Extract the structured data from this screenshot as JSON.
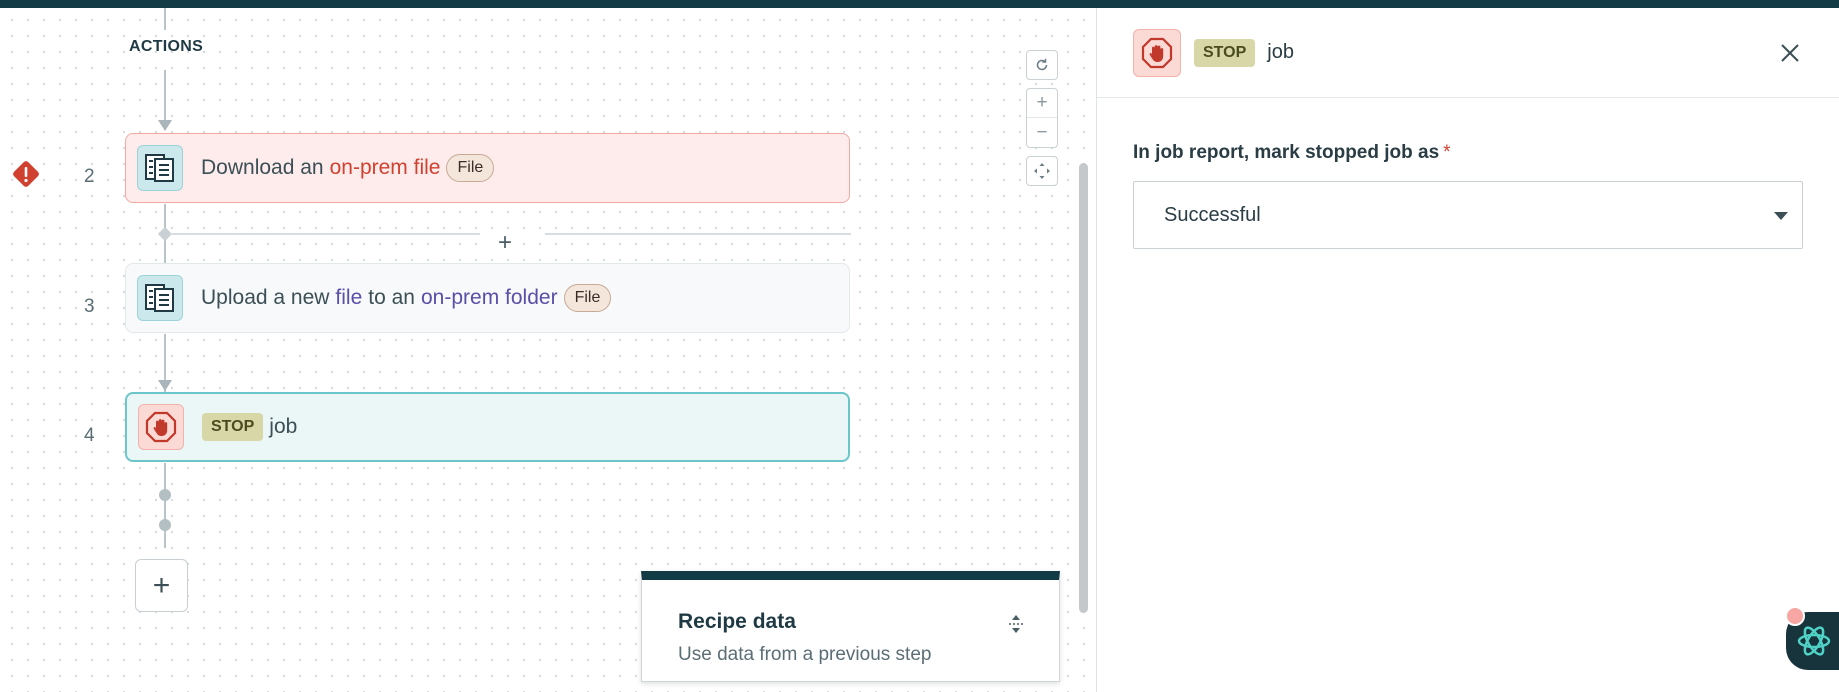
{
  "canvas": {
    "section_label": "ACTIONS",
    "steps": [
      {
        "number": "2",
        "status": "error",
        "icon": "on-prem-file-icon",
        "parts": [
          "Download an",
          "on-prem file"
        ],
        "badge": "File"
      },
      {
        "number": "3",
        "status": "normal",
        "icon": "on-prem-file-icon",
        "parts": [
          "Upload a new",
          "file",
          "to an",
          "on-prem folder"
        ],
        "badge": "File"
      },
      {
        "number": "4",
        "status": "selected",
        "icon": "stop-hand-icon",
        "keyword": "STOP",
        "label": "job"
      }
    ],
    "insert_step_symbol": "+",
    "add_step_symbol": "+",
    "zoom_controls": {
      "reset_icon": "refresh-icon",
      "zoom_in": "+",
      "zoom_out": "−",
      "fit_icon": "fit-view-icon"
    }
  },
  "recipe_data": {
    "title": "Recipe data",
    "subtitle": "Use data from a previous step"
  },
  "panel": {
    "keyword": "STOP",
    "title": "job",
    "field_label": "In job report, mark stopped job as",
    "required_mark": "*",
    "select_value": "Successful"
  },
  "colors": {
    "brand_dark": "#133b45",
    "error": "#d1412f",
    "selected_border": "#6cc6c9",
    "link_purple": "#5a4fa8"
  }
}
